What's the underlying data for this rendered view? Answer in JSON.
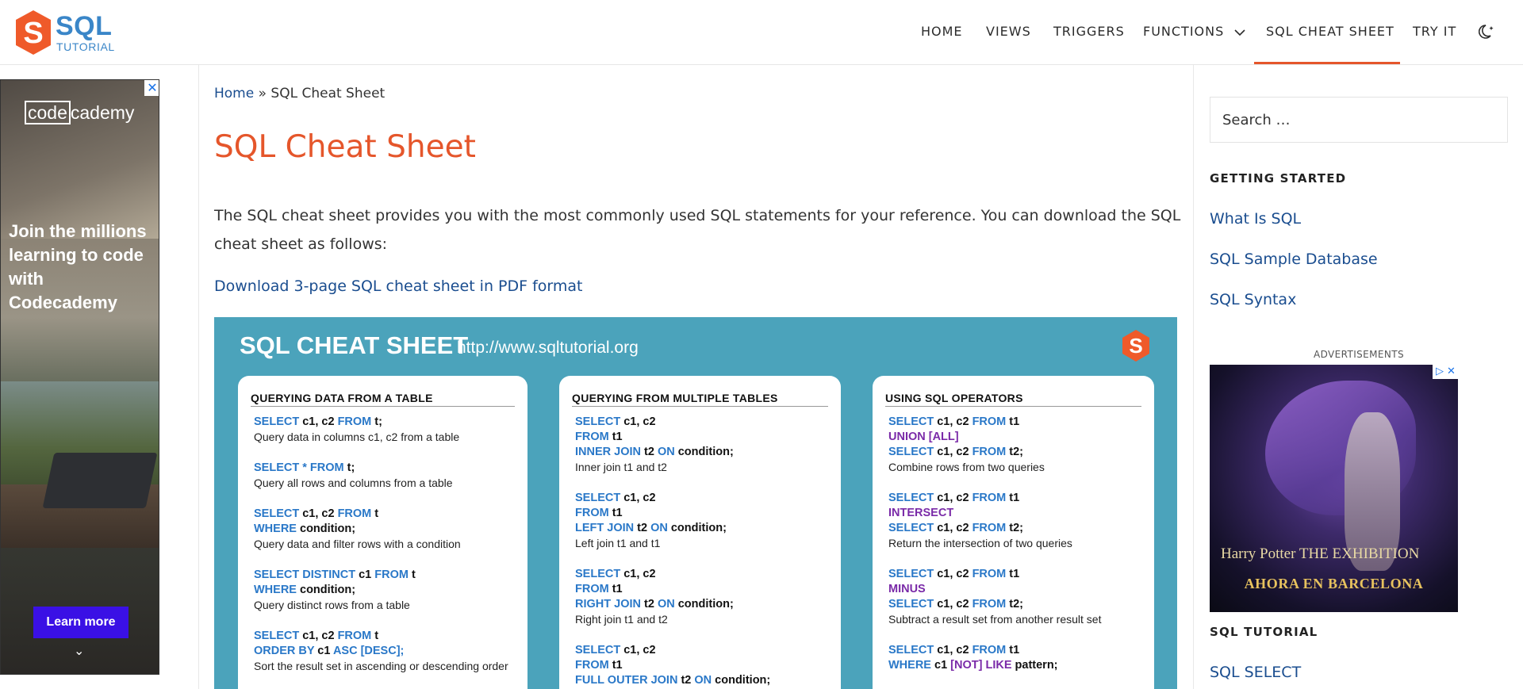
{
  "header": {
    "logo": {
      "word": "SQL",
      "sub": "TUTORIAL",
      "mark_letter": "S"
    },
    "nav": [
      {
        "label": "HOME"
      },
      {
        "label": "VIEWS"
      },
      {
        "label": "TRIGGERS"
      },
      {
        "label": "FUNCTIONS"
      },
      {
        "label": "SQL CHEAT SHEET",
        "active": true
      },
      {
        "label": "TRY IT"
      }
    ],
    "theme_toggle_icon": "moon-star-icon"
  },
  "left_ad": {
    "close": "✕",
    "brand_boxed": "code",
    "brand_rest": "cademy",
    "headline": "Join the millions learning to code with Codecademy",
    "cta": "Learn more",
    "chevron": "⌄"
  },
  "breadcrumb": {
    "home": "Home",
    "sep": " » ",
    "current": "SQL Cheat Sheet"
  },
  "main": {
    "title": "SQL Cheat Sheet",
    "intro": "The SQL cheat sheet provides you with the most commonly used SQL statements for your reference. You can download the SQL cheat sheet as follows:",
    "download_link": "Download 3-page SQL cheat sheet in PDF format"
  },
  "cheat_sheet": {
    "title": "SQL CHEAT SHEET",
    "url": "http://www.sqltutorial.org",
    "columns": [
      {
        "heading": "QUERYING DATA FROM A TABLE",
        "blocks": [
          {
            "lines": [
              [
                [
                  "kw",
                  "SELECT"
                ],
                [
                  "t",
                  " c1, c2 "
                ],
                [
                  "kw",
                  "FROM"
                ],
                [
                  "t",
                  " t;"
                ]
              ]
            ],
            "desc": "Query data in columns c1, c2 from a table"
          },
          {
            "lines": [
              [
                [
                  "kw",
                  "SELECT * FROM"
                ],
                [
                  "t",
                  " t;"
                ]
              ]
            ],
            "desc": "Query all rows and columns from a table"
          },
          {
            "lines": [
              [
                [
                  "kw",
                  "SELECT"
                ],
                [
                  "t",
                  " c1, c2 "
                ],
                [
                  "kw",
                  "FROM"
                ],
                [
                  "t",
                  " t"
                ]
              ],
              [
                [
                  "kw",
                  "WHERE"
                ],
                [
                  "t",
                  " condition;"
                ]
              ]
            ],
            "desc": "Query data and filter rows with a condition"
          },
          {
            "lines": [
              [
                [
                  "kw",
                  "SELECT DISTINCT"
                ],
                [
                  "t",
                  " c1 "
                ],
                [
                  "kw",
                  "FROM"
                ],
                [
                  "t",
                  " t"
                ]
              ],
              [
                [
                  "kw",
                  "WHERE"
                ],
                [
                  "t",
                  " condition;"
                ]
              ]
            ],
            "desc": "Query distinct rows from a table"
          },
          {
            "lines": [
              [
                [
                  "kw",
                  "SELECT"
                ],
                [
                  "t",
                  " c1, c2 "
                ],
                [
                  "kw",
                  "FROM"
                ],
                [
                  "t",
                  " t"
                ]
              ],
              [
                [
                  "kw",
                  "ORDER BY"
                ],
                [
                  "t",
                  " c1 "
                ],
                [
                  "kw",
                  "ASC [DESC];"
                ]
              ]
            ],
            "desc": "Sort the result set in ascending or descending order"
          }
        ]
      },
      {
        "heading": "QUERYING FROM MULTIPLE TABLES",
        "blocks": [
          {
            "lines": [
              [
                [
                  "kw",
                  "SELECT"
                ],
                [
                  "t",
                  " c1, c2"
                ]
              ],
              [
                [
                  "kw",
                  "FROM"
                ],
                [
                  "t",
                  " t1"
                ]
              ],
              [
                [
                  "kw",
                  "INNER JOIN"
                ],
                [
                  "t",
                  " t2 "
                ],
                [
                  "kw",
                  "ON"
                ],
                [
                  "t",
                  " condition;"
                ]
              ]
            ],
            "desc": "Inner join t1 and t2"
          },
          {
            "lines": [
              [
                [
                  "kw",
                  "SELECT"
                ],
                [
                  "t",
                  " c1, c2"
                ]
              ],
              [
                [
                  "kw",
                  "FROM"
                ],
                [
                  "t",
                  " t1"
                ]
              ],
              [
                [
                  "kw",
                  "LEFT JOIN"
                ],
                [
                  "t",
                  " t2 "
                ],
                [
                  "kw",
                  "ON"
                ],
                [
                  "t",
                  " condition;"
                ]
              ]
            ],
            "desc": "Left join t1 and t1"
          },
          {
            "lines": [
              [
                [
                  "kw",
                  "SELECT"
                ],
                [
                  "t",
                  " c1, c2"
                ]
              ],
              [
                [
                  "kw",
                  "FROM"
                ],
                [
                  "t",
                  " t1"
                ]
              ],
              [
                [
                  "kw",
                  "RIGHT JOIN"
                ],
                [
                  "t",
                  " t2 "
                ],
                [
                  "kw",
                  "ON"
                ],
                [
                  "t",
                  " condition;"
                ]
              ]
            ],
            "desc": "Right join t1 and t2"
          },
          {
            "lines": [
              [
                [
                  "kw",
                  "SELECT"
                ],
                [
                  "t",
                  " c1, c2"
                ]
              ],
              [
                [
                  "kw",
                  "FROM"
                ],
                [
                  "t",
                  " t1"
                ]
              ],
              [
                [
                  "kw",
                  "FULL OUTER JOIN"
                ],
                [
                  "t",
                  " t2 "
                ],
                [
                  "kw",
                  "ON"
                ],
                [
                  "t",
                  " condition;"
                ]
              ]
            ],
            "desc": ""
          }
        ]
      },
      {
        "heading": "USING SQL OPERATORS",
        "blocks": [
          {
            "lines": [
              [
                [
                  "kw",
                  "SELECT"
                ],
                [
                  "t",
                  " c1, c2 "
                ],
                [
                  "kw",
                  "FROM"
                ],
                [
                  "t",
                  " t1"
                ]
              ],
              [
                [
                  "kw2",
                  "UNION [ALL]"
                ]
              ],
              [
                [
                  "kw",
                  "SELECT"
                ],
                [
                  "t",
                  " c1, c2 "
                ],
                [
                  "kw",
                  "FROM"
                ],
                [
                  "t",
                  " t2;"
                ]
              ]
            ],
            "desc": "Combine rows from two queries"
          },
          {
            "lines": [
              [
                [
                  "kw",
                  "SELECT"
                ],
                [
                  "t",
                  " c1, c2 "
                ],
                [
                  "kw",
                  "FROM"
                ],
                [
                  "t",
                  " t1"
                ]
              ],
              [
                [
                  "kw2",
                  "INTERSECT"
                ]
              ],
              [
                [
                  "kw",
                  "SELECT"
                ],
                [
                  "t",
                  " c1, c2 "
                ],
                [
                  "kw",
                  "FROM"
                ],
                [
                  "t",
                  " t2;"
                ]
              ]
            ],
            "desc": "Return the intersection of two queries"
          },
          {
            "lines": [
              [
                [
                  "kw",
                  "SELECT"
                ],
                [
                  "t",
                  " c1, c2 "
                ],
                [
                  "kw",
                  "FROM"
                ],
                [
                  "t",
                  " t1"
                ]
              ],
              [
                [
                  "kw2",
                  "MINUS"
                ]
              ],
              [
                [
                  "kw",
                  "SELECT"
                ],
                [
                  "t",
                  " c1, c2 "
                ],
                [
                  "kw",
                  "FROM"
                ],
                [
                  "t",
                  " t2;"
                ]
              ]
            ],
            "desc": "Subtract a result set from another result set"
          },
          {
            "lines": [
              [
                [
                  "kw",
                  "SELECT"
                ],
                [
                  "t",
                  " c1, c2 "
                ],
                [
                  "kw",
                  "FROM"
                ],
                [
                  "t",
                  " t1"
                ]
              ],
              [
                [
                  "kw",
                  "WHERE"
                ],
                [
                  "t",
                  " c1 "
                ],
                [
                  "kw2",
                  "[NOT] LIKE"
                ],
                [
                  "t",
                  " pattern;"
                ]
              ]
            ],
            "desc": ""
          }
        ]
      }
    ]
  },
  "sidebar": {
    "search_placeholder": "Search …",
    "getting_started_heading": "GETTING STARTED",
    "getting_started_links": [
      "What Is SQL",
      "SQL Sample Database",
      "SQL Syntax"
    ],
    "ads_label": "ADVERTISEMENTS",
    "ad": {
      "line1": "Harry Potter  THE EXHIBITION",
      "line2": "AHORA EN BARCELONA"
    },
    "tutorial_heading": "SQL TUTORIAL",
    "tutorial_links": [
      "SQL SELECT"
    ]
  },
  "colors": {
    "accent": "#e5562b",
    "link": "#1a4d8f",
    "brand_blue": "#3a86c8",
    "sheet_bg": "#4ba3bb",
    "keyword": "#2a78c8",
    "keyword_purple": "#7a2aa8"
  }
}
